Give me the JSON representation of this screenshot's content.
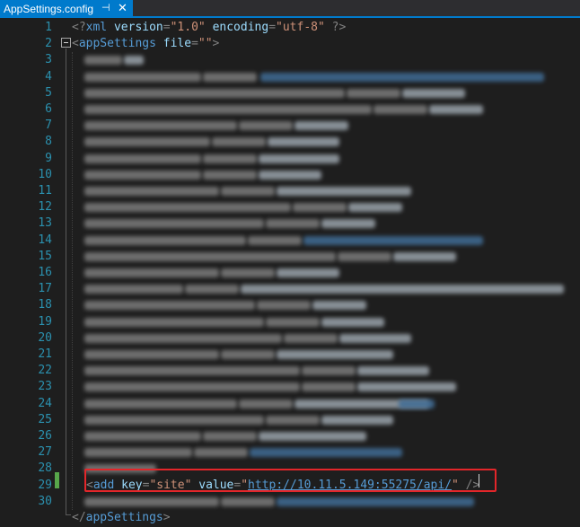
{
  "tab": {
    "title": "AppSettings.config",
    "pin_glyph": "⊣",
    "close_glyph": "✕"
  },
  "line_numbers": [
    "1",
    "2",
    "3",
    "4",
    "5",
    "6",
    "7",
    "8",
    "9",
    "10",
    "11",
    "12",
    "13",
    "14",
    "15",
    "16",
    "17",
    "18",
    "19",
    "20",
    "21",
    "22",
    "23",
    "24",
    "25",
    "26",
    "27",
    "28",
    "29",
    "30"
  ],
  "code": {
    "line1": {
      "open": "<?",
      "tag": "xml",
      "attr1": "version",
      "val1": "\"1.0\"",
      "attr2": "encoding",
      "val2": "\"utf-8\"",
      "close": "?>"
    },
    "line2": {
      "open": "<",
      "tag": "appSettings",
      "attr": "file",
      "eq": "=",
      "val": "\"\"",
      "close": ">"
    },
    "line28": {
      "open": "<",
      "tag": "add",
      "attr1": "key",
      "val1": "\"site\"",
      "attr2": "value",
      "val2_q1": "\"",
      "val2_link": "http://10.11.5.149:55275/api/",
      "val2_q2": "\"",
      "close": " />"
    },
    "line30": {
      "open": "</",
      "tag": "appSettings",
      "close": ">"
    },
    "obscured_lines": "3-27, 29 (blurred)"
  },
  "colors": {
    "accent_tab": "#007acc",
    "highlight_box": "#e3262a",
    "line_number": "#2b91af",
    "change_marker": "#57a64a"
  }
}
